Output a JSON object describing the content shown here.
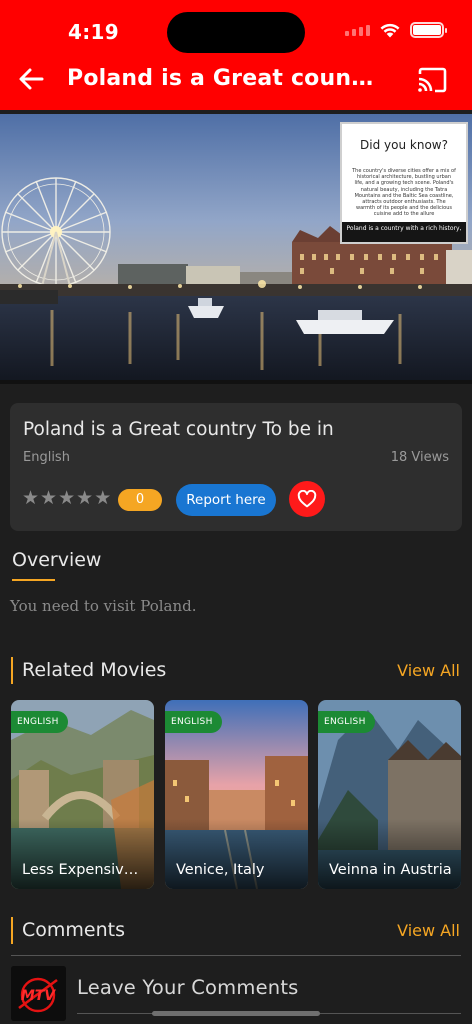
{
  "status_bar": {
    "time": "4:19",
    "icons": [
      "cellular-signal-icon",
      "wifi-icon",
      "battery-icon"
    ]
  },
  "app_bar": {
    "title": "Poland is a Great country To be in",
    "back_icon": "arrow-left-icon",
    "cast_icon": "cast-icon",
    "color": "#ff0000"
  },
  "hero": {
    "overlay_title": "Did you know?",
    "overlay_body": "The country's diverse cities offer a mix of historical architecture, bustling urban life, and a growing tech scene. Poland's natural beauty, including the Tatra Mountains and the Baltic Sea coastline, attracts outdoor enthusiasts. The warmth of its people and the delicious cuisine add to the allure",
    "overlay_caption": "Poland is a country with a rich history,"
  },
  "info": {
    "title": "Poland is a Great country To be in",
    "language": "English",
    "views": "18 Views",
    "rating_count": "0",
    "stars": 5,
    "report_label": "Report here",
    "favorite_icon": "heart-icon"
  },
  "overview": {
    "heading": "Overview",
    "text": "You need to visit Poland."
  },
  "related": {
    "heading": "Related Movies",
    "view_all": "View All",
    "items": [
      {
        "badge": "ENGLISH",
        "title": "Less Expensive Places"
      },
      {
        "badge": "ENGLISH",
        "title": "Venice, Italy"
      },
      {
        "badge": "ENGLISH",
        "title": "Veinna in Austria"
      }
    ]
  },
  "comments": {
    "heading": "Comments",
    "view_all": "View All",
    "placeholder": "Leave Your Comments",
    "logo_text": "MTV"
  },
  "colors": {
    "accent": "#f5a623",
    "primary_red": "#ff0000",
    "report_blue": "#1976d2",
    "badge_green": "#1c8a34",
    "background": "#1e1e1e",
    "card": "#2e2e2e"
  }
}
